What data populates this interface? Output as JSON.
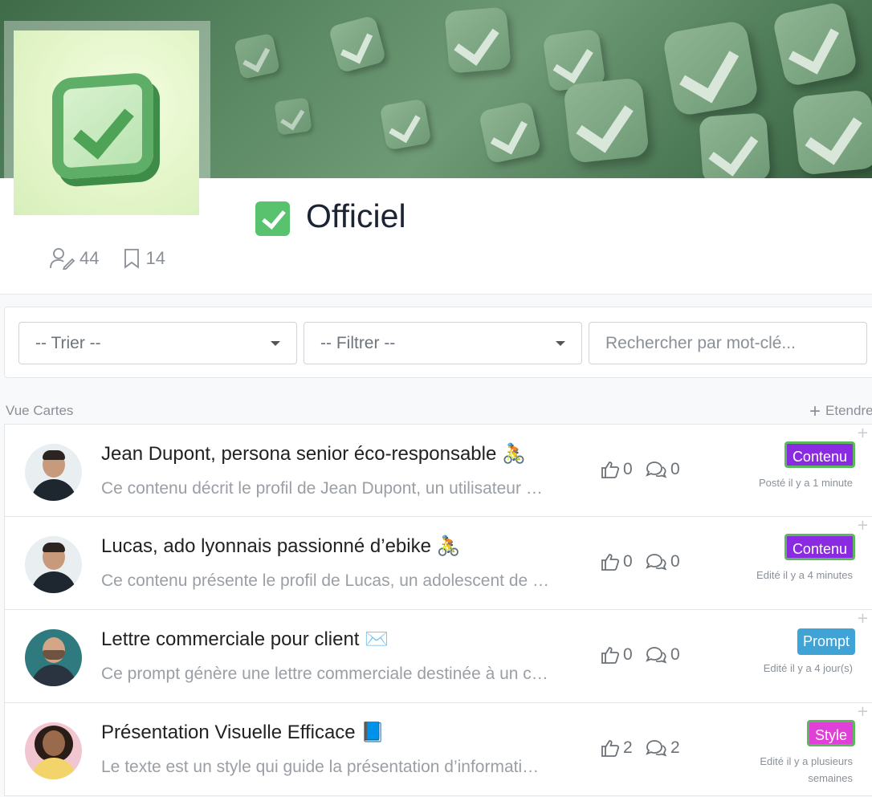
{
  "header": {
    "title": "Officiel",
    "stats": {
      "authors_count": "44",
      "bookmarks_count": "14"
    }
  },
  "filters": {
    "sort": {
      "selected": "-- Trier --"
    },
    "filter": {
      "selected": "-- Filtrer --"
    },
    "search": {
      "placeholder": "Rechercher par mot-clé..."
    }
  },
  "list": {
    "view_label": "Vue Cartes",
    "expand_label": "Etendre",
    "cards": [
      {
        "title": "Jean Dupont, persona senior éco-responsable 🚴",
        "description": "Ce contenu décrit le profil de Jean Dupont, un utilisateur …",
        "likes": "0",
        "comments": "0",
        "badge": "Contenu",
        "badge_color": "#8a2be2",
        "meta": "Posté il y a 1 minute",
        "avatar": "man-smiling-dark-suit"
      },
      {
        "title": "Lucas, ado lyonnais passionné d’ebike 🚴",
        "description": "Ce contenu présente le profil de Lucas, un adolescent de …",
        "likes": "0",
        "comments": "0",
        "badge": "Contenu",
        "badge_color": "#8a2be2",
        "meta": "Edité il y a 4 minutes",
        "avatar": "man-smiling-dark-suit"
      },
      {
        "title": "Lettre commerciale pour client ✉️",
        "description": "Ce prompt génère une lettre commerciale destinée à un c…",
        "likes": "0",
        "comments": "0",
        "badge": "Prompt",
        "badge_color": "#3fa3d6",
        "meta": "Edité il y a 4 jour(s)",
        "avatar": "man-bearded-teal-background"
      },
      {
        "title": "Présentation Visuelle Efficace 📘",
        "description": "Le texte est un style qui guide la présentation d’informati…",
        "likes": "2",
        "comments": "2",
        "badge": "Style",
        "badge_color": "#e03fd8",
        "meta": "Edité il y a plusieurs semaines",
        "avatar": "woman-curly-hair-pink-background"
      }
    ]
  },
  "colors": {
    "accent_green": "#58c26f",
    "badge_border": "#5cb85c"
  }
}
